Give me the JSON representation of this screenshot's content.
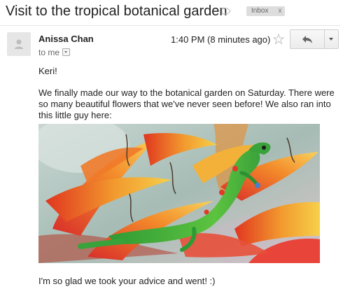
{
  "subject": "Visit to the tropical botanical garden",
  "labels": [
    {
      "text": "Inbox",
      "remove": "x"
    }
  ],
  "sender": {
    "name": "Anissa Chan"
  },
  "recipient": {
    "text": "to me"
  },
  "timestamp": "1:40 PM (8 minutes ago)",
  "icons": {
    "label": "label-icon",
    "avatar": "person-icon",
    "details": "chevron-down-icon",
    "star": "star-icon",
    "reply": "reply-icon",
    "more": "chevron-down-icon"
  },
  "body": {
    "greeting": "Keri!",
    "paragraph": "We finally made our way to the botanical garden on Saturday. There were so many beautiful flowers that we've never seen before! We also ran into this little guy here:",
    "closing": "I'm so glad we took your advice and went! :)"
  },
  "colors": {
    "chip_bg": "#dddddd",
    "text": "#222222",
    "muted": "#666666",
    "lizard_green": "#3fa93a",
    "flower_red": "#e4442b",
    "flower_orange": "#f2a233"
  }
}
